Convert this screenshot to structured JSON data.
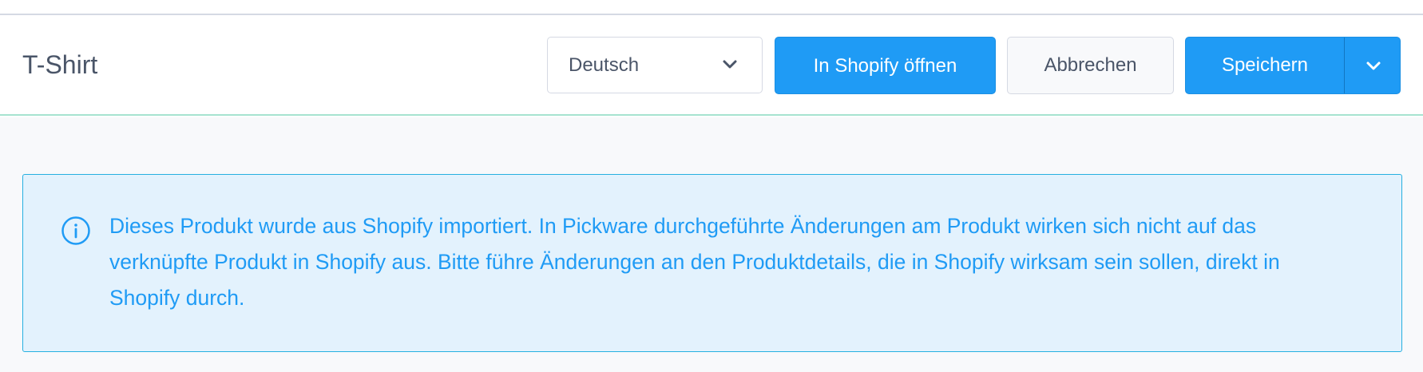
{
  "header": {
    "title": "T-Shirt",
    "language_select": {
      "value": "Deutsch",
      "icon": "chevron-down-icon"
    },
    "open_shopify_label": "In Shopify öffnen",
    "cancel_label": "Abbrechen",
    "save_label": "Speichern",
    "save_dropdown_icon": "chevron-down-icon"
  },
  "notice": {
    "icon": "info-icon",
    "text": "Dieses Produkt wurde aus Shopify importiert. In Pickware durchgeführte Änderungen am Produkt wirken sich nicht auf das verknüpfte Produkt in Shopify aus. Bitte führe Änderungen an den Produktdetails, die in Shopify wirksam sein sollen, direkt in Shopify durch."
  },
  "colors": {
    "primary": "#1f9bf5",
    "text": "#4a5568",
    "notice_background": "#e3f2fd",
    "notice_border": "#26b0e0",
    "header_divider": "#a6e3d0"
  }
}
